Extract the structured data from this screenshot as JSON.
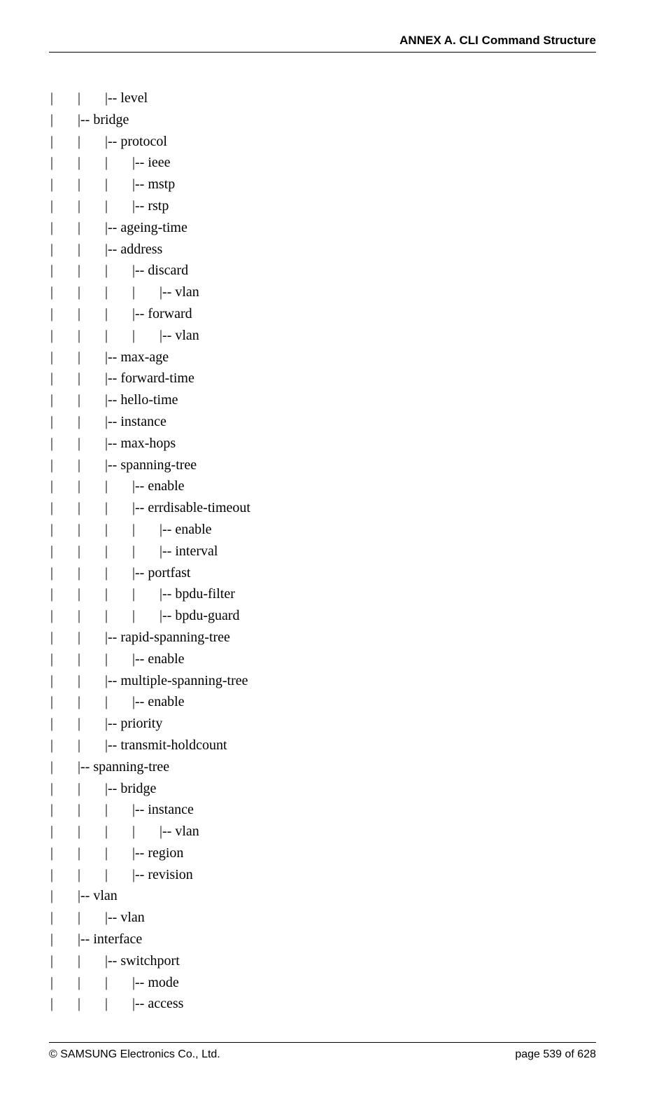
{
  "header": {
    "title": "ANNEX A. CLI Command Structure"
  },
  "tree_lines": [
    "|       |       |-- level",
    "|       |-- bridge",
    "|       |       |-- protocol",
    "|       |       |       |-- ieee",
    "|       |       |       |-- mstp",
    "|       |       |       |-- rstp",
    "|       |       |-- ageing-time",
    "|       |       |-- address",
    "|       |       |       |-- discard",
    "|       |       |       |       |-- vlan",
    "|       |       |       |-- forward",
    "|       |       |       |       |-- vlan",
    "|       |       |-- max-age",
    "|       |       |-- forward-time",
    "|       |       |-- hello-time",
    "|       |       |-- instance",
    "|       |       |-- max-hops",
    "|       |       |-- spanning-tree",
    "|       |       |       |-- enable",
    "|       |       |       |-- errdisable-timeout",
    "|       |       |       |       |-- enable",
    "|       |       |       |       |-- interval",
    "|       |       |       |-- portfast",
    "|       |       |       |       |-- bpdu-filter",
    "|       |       |       |       |-- bpdu-guard",
    "|       |       |-- rapid-spanning-tree",
    "|       |       |       |-- enable",
    "|       |       |-- multiple-spanning-tree",
    "|       |       |       |-- enable",
    "|       |       |-- priority",
    "|       |       |-- transmit-holdcount",
    "|       |-- spanning-tree",
    "|       |       |-- bridge",
    "|       |       |       |-- instance",
    "|       |       |       |       |-- vlan",
    "|       |       |       |-- region",
    "|       |       |       |-- revision",
    "|       |-- vlan",
    "|       |       |-- vlan",
    "|       |-- interface",
    "|       |       |-- switchport",
    "|       |       |       |-- mode",
    "|       |       |       |-- access"
  ],
  "footer": {
    "copyright": "© SAMSUNG Electronics Co., Ltd.",
    "page_info": "page 539 of 628"
  }
}
